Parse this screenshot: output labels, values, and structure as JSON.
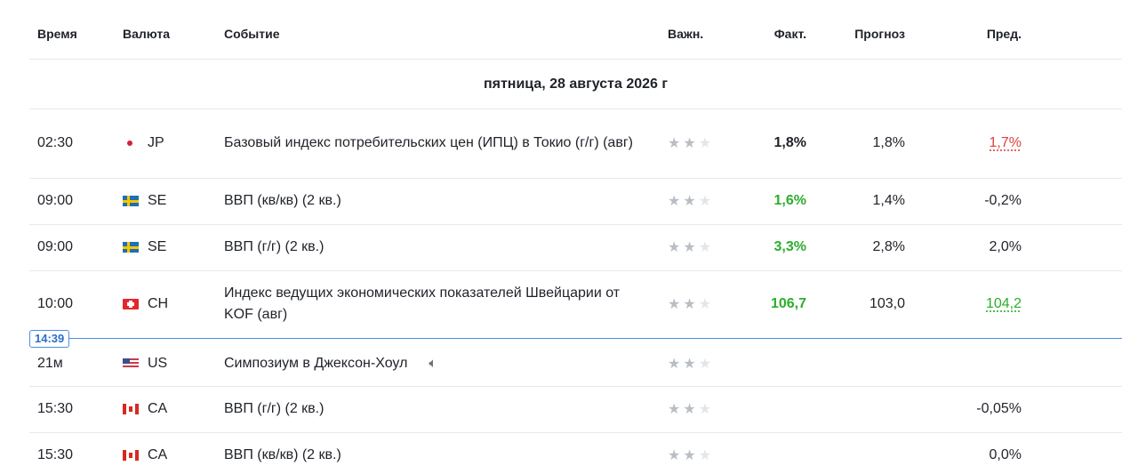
{
  "header": {
    "time": "Время",
    "currency": "Валюта",
    "event": "Событие",
    "importance": "Важн.",
    "actual": "Факт.",
    "forecast": "Прогноз",
    "previous": "Пред."
  },
  "date_label": "пятница, 28 августа 2026 г",
  "now_badge": "14:39",
  "events": [
    {
      "time": "02:30",
      "country": "JP",
      "flag": "flag-jp",
      "title": "Базовый индекс потребительских цен (ИПЦ) в Токио (г/г) (авг)",
      "stars": 2,
      "actual": "1,8%",
      "forecast": "1,8%",
      "previous": "1,7%"
    },
    {
      "time": "09:00",
      "country": "SE",
      "flag": "flag-se",
      "title": "ВВП (кв/кв) (2 кв.)",
      "stars": 2,
      "actual": "1,6%",
      "forecast": "1,4%",
      "previous": "-0,2%"
    },
    {
      "time": "09:00",
      "country": "SE",
      "flag": "flag-se",
      "title": "ВВП (г/г) (2 кв.)",
      "stars": 2,
      "actual": "3,3%",
      "forecast": "2,8%",
      "previous": "2,0%"
    },
    {
      "time": "10:00",
      "country": "CH",
      "flag": "flag-ch",
      "title": "Индекс ведущих экономических показателей Швейцарии от KOF  (авг)",
      "stars": 2,
      "actual": "106,7",
      "forecast": "103,0",
      "previous": "104,2"
    },
    {
      "time": "21м",
      "country": "US",
      "flag": "flag-us",
      "title": "Симпозиум в Джексон-Хоул",
      "stars": 2,
      "actual": "",
      "forecast": "",
      "previous": ""
    },
    {
      "time": "15:30",
      "country": "CA",
      "flag": "flag-ca",
      "title": "ВВП (г/г) (2 кв.)",
      "stars": 2,
      "actual": "",
      "forecast": "",
      "previous": "-0,05%"
    },
    {
      "time": "15:30",
      "country": "CA",
      "flag": "flag-ca",
      "title": "ВВП (кв/кв) (2 кв.)",
      "stars": 2,
      "actual": "",
      "forecast": "",
      "previous": "0,0%"
    }
  ],
  "colors": {
    "positive": "#2cae2c",
    "negative": "#e0413b",
    "now_line": "#4a90e2"
  }
}
